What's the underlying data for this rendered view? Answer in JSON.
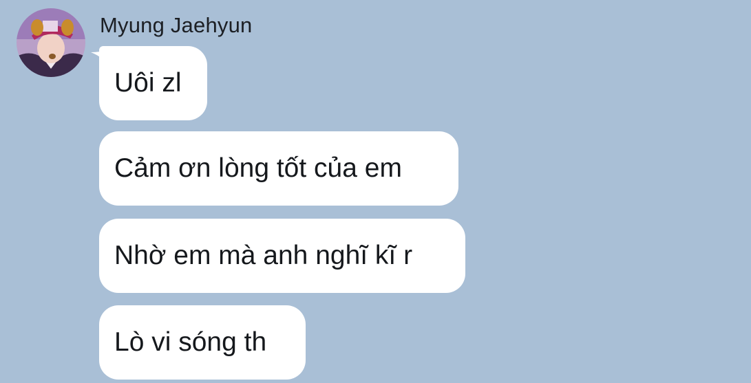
{
  "conversation": {
    "sender": {
      "name": "Myung Jaehyun",
      "avatar_icon": "profile-photo-avatar"
    },
    "messages": [
      {
        "text": "Uôi zl"
      },
      {
        "text": "Cảm ơn lòng tốt của em"
      },
      {
        "text": "Nhờ em mà anh nghĩ kĩ r"
      },
      {
        "text": "Lò vi sóng th"
      }
    ]
  },
  "colors": {
    "background": "#a9bfd6",
    "bubble": "#ffffff",
    "text": "#15181c"
  }
}
